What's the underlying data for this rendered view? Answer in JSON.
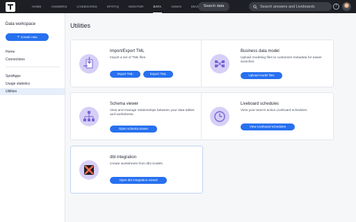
{
  "nav": {
    "items": [
      "HOME",
      "ANSWERS",
      "LIVEBOARDS",
      "SPOTIQ",
      "MONITOR",
      "DATA",
      "ADMIN",
      "DEVELOP"
    ],
    "active": "DATA",
    "search_data_label": "Search data",
    "search_placeholder": "Search answers and Liveboards",
    "help_glyph": "?"
  },
  "sidebar": {
    "title": "Data workspace",
    "create_label": "Create new",
    "group1": [
      "Home",
      "Connections"
    ],
    "group2": [
      "SpotApps",
      "Usage statistics",
      "Utilities"
    ],
    "active_item": "Utilities"
  },
  "main": {
    "title": "Utilities",
    "cards": {
      "import_export": {
        "title": "Import/Export TML",
        "description": "Import a set of TML files",
        "buttons": [
          "Import TML",
          "Export TML"
        ],
        "icon": "import-export-icon"
      },
      "business_model": {
        "title": "Business data model",
        "description": "Upload modeling files to customize metadata for easier searches",
        "buttons": [
          "Upload model files"
        ],
        "icon": "data-model-icon"
      },
      "schema_viewer": {
        "title": "Schema viewer",
        "description": "View and manage relationships between your data tables and worksheets",
        "buttons": [
          "Open schema viewer"
        ],
        "icon": "hierarchy-icon"
      },
      "liveboard_schedules": {
        "title": "Liveboard schedules",
        "description": "View your team's active Liveboard schedules",
        "buttons": [
          "View Liveboard schedules"
        ],
        "icon": "clock-icon"
      },
      "dbt": {
        "title": "dbt integration",
        "description": "Create worksheets from dbt models",
        "buttons": [
          "Open dbt integration wizard"
        ],
        "icon": "dbt-logo-icon"
      }
    }
  },
  "colors": {
    "accent": "#2770ef",
    "nav_bg": "#1d1f24",
    "icon_circle": "#d6cff7",
    "icon_purple": "#7a63d6",
    "dbt_orange": "#ff694a"
  }
}
